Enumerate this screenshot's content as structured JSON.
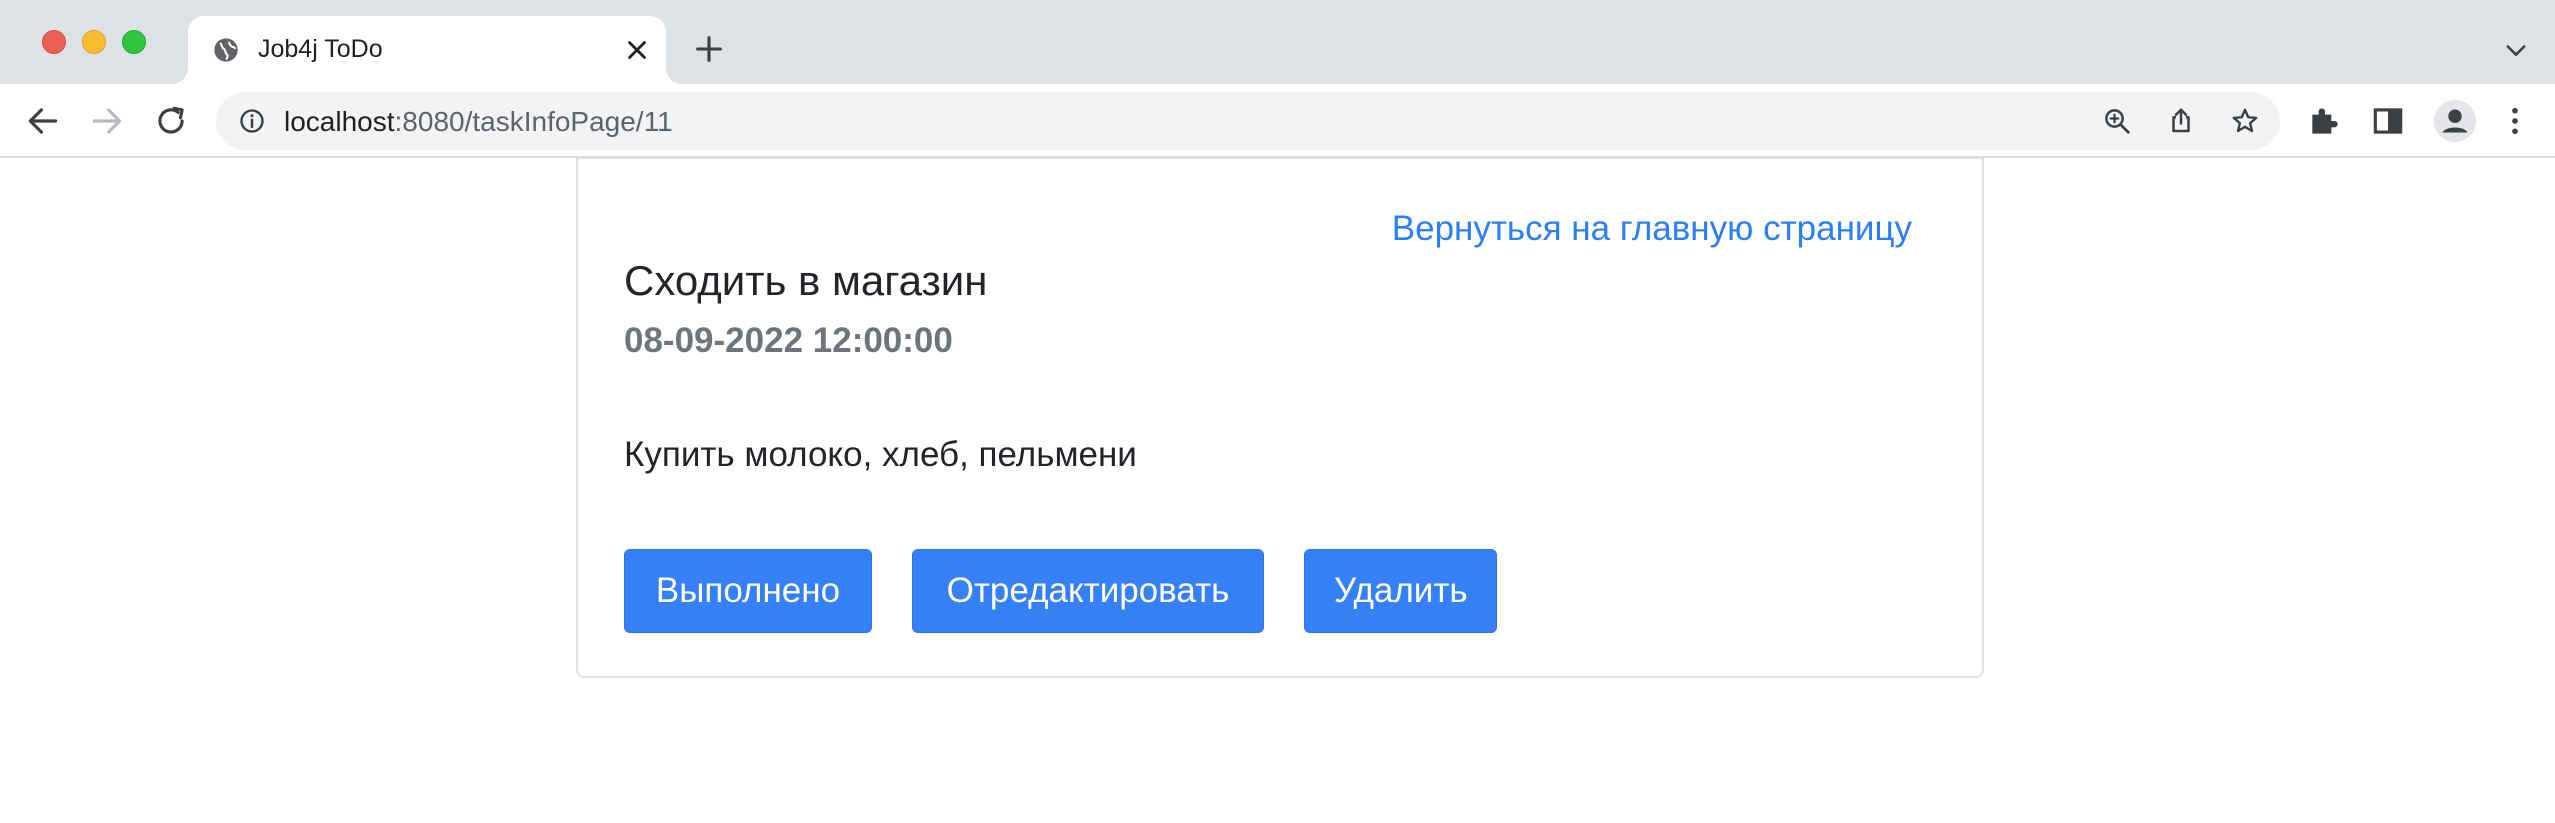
{
  "browser": {
    "tab": {
      "title": "Job4j ToDo",
      "favicon": "globe-icon"
    },
    "address_bar": {
      "host": "localhost",
      "path": ":8080/taskInfoPage/11"
    },
    "icons": {
      "back": "back-arrow-icon",
      "forward": "forward-arrow-icon",
      "reload": "reload-icon",
      "site_info": "info-icon",
      "zoom": "zoom-icon",
      "share": "share-icon",
      "bookmark": "star-icon",
      "extensions": "puzzle-icon",
      "side_panel": "side-panel-icon",
      "profile": "profile-icon",
      "menu": "kebab-menu-icon",
      "new_tab": "plus-icon",
      "tab_search": "chevron-down-icon",
      "close_tab": "close-icon"
    }
  },
  "page": {
    "back_link": "Вернуться на главную страницу",
    "task": {
      "title": "Сходить в магазин",
      "date": "08-09-2022 12:00:00",
      "description": "Купить молоко, хлеб, пельмени"
    },
    "buttons": {
      "done": "Выполнено",
      "edit": "Отредактировать",
      "delete": "Удалить"
    },
    "colors": {
      "primary": "#3580f6",
      "link": "#2b7ff5",
      "muted": "#6c757d"
    }
  }
}
